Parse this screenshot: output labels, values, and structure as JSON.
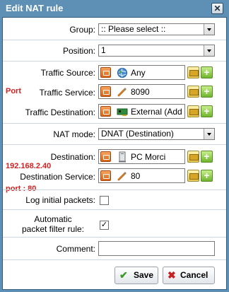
{
  "dialog": {
    "title": "Edit NAT rule",
    "close_glyph": "✕"
  },
  "fields": {
    "group": {
      "label": "Group:",
      "value": ":: Please select ::"
    },
    "position": {
      "label": "Position:",
      "value": "1"
    },
    "traffic_source": {
      "label": "Traffic Source:",
      "value": "Any",
      "icon": "globe-icon"
    },
    "traffic_service": {
      "label": "Traffic Service:",
      "value": "8090",
      "icon": "service-icon"
    },
    "traffic_destination": {
      "label": "Traffic Destination:",
      "value": "External (Add",
      "icon": "network-card-icon"
    },
    "nat_mode": {
      "label": "NAT mode:",
      "value": "DNAT (Destination)"
    },
    "destination": {
      "label": "Destination:",
      "value": "PC Morci",
      "icon": "host-icon"
    },
    "destination_service": {
      "label": "Destination Service:",
      "value": "80",
      "icon": "service-icon"
    },
    "log_initial": {
      "label": "Log initial packets:",
      "checked": false
    },
    "auto_filter": {
      "label_line1": "Automatic",
      "label_line2": "packet filter rule:",
      "checked": true,
      "check_glyph": "✓"
    },
    "comment": {
      "label": "Comment:",
      "value": ""
    }
  },
  "annotations": {
    "port": "Port",
    "ip": "192.168.2.40",
    "port80": "port : 80"
  },
  "buttons": {
    "save": {
      "label": "Save",
      "icon_glyph": "✔"
    },
    "cancel": {
      "label": "Cancel",
      "icon_glyph": "✖"
    }
  },
  "colors": {
    "title_bar": "#5e8fb5",
    "annotation": "#d42020",
    "save_icon": "#3a9a2a",
    "cancel_icon": "#c82020"
  }
}
